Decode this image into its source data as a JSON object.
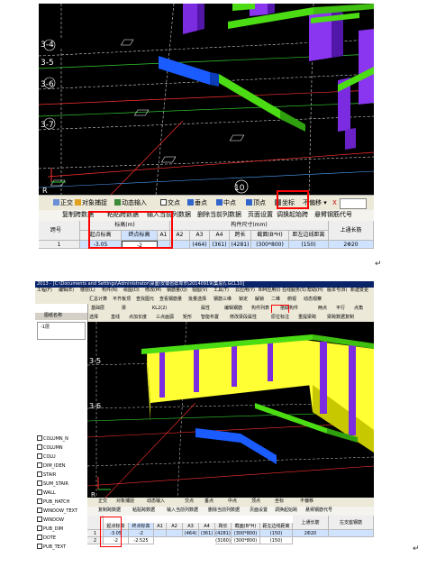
{
  "top": {
    "axis_labels": [
      "3-4",
      "3-5",
      "3-6",
      "3-7"
    ],
    "bottom_axis": "10",
    "bottom_r": "R",
    "toolbar": {
      "items": [
        "正交",
        "对象捕捉",
        "动态输入",
        "交点",
        "垂点",
        "中点",
        "顶点",
        "坐标",
        "不偏移"
      ],
      "x_label": "X"
    },
    "menu": [
      "复制跨数据",
      "粘贴跨数据",
      "输入当前列数据",
      "删除当前列数据",
      "页面设置",
      "调换起始跨",
      "悬臂钢筋代号"
    ],
    "grid": {
      "header1": {
        "span": "跨号",
        "elev": "标高(m)",
        "size": "构件尺寸(mm)",
        "top": "上通长筋"
      },
      "header2": [
        "起点标高",
        "终点标高",
        "A1",
        "A2",
        "A3",
        "A4",
        "跨长",
        "截面(B*H)",
        "距左边线距离"
      ],
      "row": {
        "span": "1",
        "start": "-3.05",
        "end": "-2",
        "a1": "",
        "a2": "",
        "a3": "(464)",
        "a4": "(361)",
        "len": "(4281)",
        "section": "(300*800)",
        "dist": "(150)",
        "top_bar": "2Φ20"
      }
    }
  },
  "bottom": {
    "title": "2013 - [C:\\Documents and Settings\\Administrator\\桌面\\安徽省蚌埠市\\20140919(集思)\\.GCL10]",
    "menu": [
      "工程(F)",
      "编辑(E)",
      "楼层(L)",
      "构件(N)",
      "绘图(D)",
      "修改(M)",
      "钢筋量(Q)",
      "视图(V)",
      "工具(T)",
      "云应用(Y)",
      "BIM应用(I)",
      "在线服务(S)",
      "帮助(H)",
      "版本号(B)",
      "新建变更",
      "广联达"
    ],
    "toolbar_a": [
      "汇总计算",
      "平齐板顶",
      "查找图元",
      "查看钢筋量",
      "批量选择",
      "钢筋三维",
      "锁定",
      "解锁",
      "二维",
      "俯视",
      "动态观察"
    ],
    "toolbar_b": [
      "基础层",
      "梁",
      "KL2(2)",
      "属性",
      "编辑钢筋",
      "构件列表",
      "拾取构件",
      "两点",
      "平行",
      "点角"
    ],
    "toolbar_c": [
      "选择",
      "直线",
      "点加长度",
      "三点画弧",
      "矩形",
      "智能布置",
      "修改梁段属性",
      "原位标注",
      "重提梁跨",
      "梁跨数据复制"
    ],
    "side_list": [
      "COLUMN_N",
      "COLUMN",
      "COLU",
      "DIM_IDEN",
      "STAIR",
      "SUM_STAIR",
      "WALL",
      "PUB_HATCH",
      "WINDOW_TEXT",
      "WINDOW",
      "PUB_DIM",
      "DOTE",
      "PUB_TEXT"
    ],
    "side_header": [
      "图纸名称",
      "-1层"
    ],
    "axis_labels": [
      "3-5",
      "3-6"
    ],
    "bottom_r": "R",
    "toolbar": [
      "正交",
      "对象捕捉",
      "动态输入",
      "交点",
      "垂点",
      "中点",
      "顶点",
      "坐标",
      "不偏移"
    ],
    "menu2": [
      "复制跨数据",
      "粘贴跨数据",
      "输入当前列数据",
      "删除当前列数据",
      "页面设置",
      "调换起始跨",
      "悬臂钢筋代号"
    ],
    "grid": {
      "header2": [
        "起点标高",
        "终点标高",
        "A1",
        "A2",
        "A3",
        "A4",
        "跨长",
        "截面(B*H)",
        "距左边线距离",
        "上通长筋",
        "左支座钢筋"
      ],
      "rows": [
        {
          "span": "1",
          "start": "-3.05",
          "end": "-2",
          "a3": "(464)",
          "a4": "(361)",
          "len": "(4281)",
          "section": "(300*800)",
          "dist": "(150)",
          "top_bar": "2Φ20"
        },
        {
          "span": "2",
          "start": "-2",
          "end": "-2.525",
          "a3": "",
          "a4": "",
          "len": "(3160)",
          "section": "(300*800)",
          "dist": "(150)",
          "top_bar": ""
        }
      ]
    }
  },
  "return_marks": [
    "↵",
    "↵"
  ]
}
